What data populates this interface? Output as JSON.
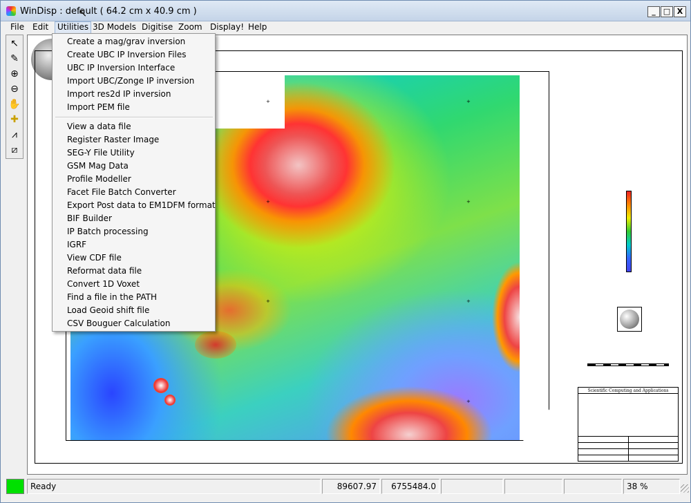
{
  "window": {
    "title": "WinDisp : default ( 64.2 cm x 40.9 cm )",
    "controls": {
      "minimize": "_",
      "maximize": "□",
      "close": "X"
    }
  },
  "menubar": {
    "items": [
      "File",
      "Edit",
      "Utilities",
      "3D Models",
      "Digitise",
      "Zoom",
      "Display!",
      "Help"
    ],
    "open_menu": "Utilities"
  },
  "utilities_menu": {
    "group1": [
      "Create a mag/grav inversion",
      "Create UBC IP Inversion Files",
      "UBC IP Inversion Interface",
      "Import UBC/Zonge IP inversion",
      "Import res2d IP inversion",
      "Import PEM file"
    ],
    "group2": [
      "View a data file",
      "Register Raster Image",
      "SEG-Y File Utility",
      "GSM Mag Data",
      "Profile Modeller",
      "Facet File Batch Converter",
      "Export Post data to EM1DFM format",
      "BIF Builder",
      "IP Batch processing",
      "IGRF",
      "View CDF file",
      "Reformat data file",
      "Convert 1D Voxet",
      "Find a file in the PATH",
      "Load Geoid shift file",
      "CSV Bouguer Calculation"
    ]
  },
  "toolbar": {
    "tools": [
      "pointer-icon",
      "pan-tool-icon",
      "zoom-in-icon",
      "zoom-out-icon",
      "hand-icon",
      "crosshair-icon",
      "profile-icon",
      "image-edit-icon"
    ]
  },
  "title_block": {
    "company": "Scientific Computing and Applications"
  },
  "status": {
    "text": "Ready",
    "x_coord": "89607.97",
    "y_coord": "6755484.0",
    "zoom": "38 %",
    "indicator_color": "#00e000"
  }
}
